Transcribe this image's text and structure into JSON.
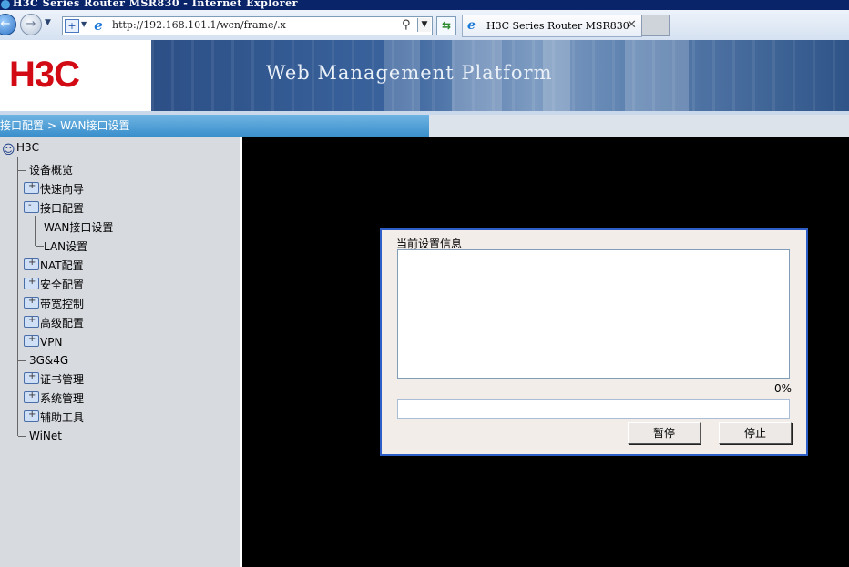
{
  "window": {
    "title": "H3C Series Router MSR830 - Internet Explorer"
  },
  "browser": {
    "address": "http://192.168.101.1/wcn/frame/.x",
    "tab_label": "H3C Series Router MSR830"
  },
  "banner": {
    "logo": "H3C",
    "title": "Web Management Platform"
  },
  "breadcrumb": {
    "items": [
      "接口配置",
      "WAN接口设置"
    ],
    "separator": ">"
  },
  "tree": {
    "root": "H3C",
    "items": [
      {
        "label": "设备概览",
        "level": 1,
        "folder": false
      },
      {
        "label": "快速向导",
        "level": 1,
        "folder": true,
        "open": false
      },
      {
        "label": "接口配置",
        "level": 1,
        "folder": true,
        "open": true
      },
      {
        "label": "WAN接口设置",
        "level": 2,
        "folder": false
      },
      {
        "label": "LAN设置",
        "level": 2,
        "folder": false
      },
      {
        "label": "NAT配置",
        "level": 1,
        "folder": true,
        "open": false
      },
      {
        "label": "安全配置",
        "level": 1,
        "folder": true,
        "open": false
      },
      {
        "label": "带宽控制",
        "level": 1,
        "folder": true,
        "open": false
      },
      {
        "label": "高级配置",
        "level": 1,
        "folder": true,
        "open": false
      },
      {
        "label": "VPN",
        "level": 1,
        "folder": true,
        "open": false
      },
      {
        "label": "3G&4G",
        "level": 1,
        "folder": false
      },
      {
        "label": "证书管理",
        "level": 1,
        "folder": true,
        "open": false
      },
      {
        "label": "系统管理",
        "level": 1,
        "folder": true,
        "open": false
      },
      {
        "label": "辅助工具",
        "level": 1,
        "folder": true,
        "open": false
      },
      {
        "label": "WiNet",
        "level": 1,
        "folder": false
      }
    ]
  },
  "dialog": {
    "title": "当前设置信息",
    "info_text": "",
    "progress_percent": 0,
    "progress_label": "0%",
    "pause_label": "暂停",
    "stop_label": "停止"
  },
  "colors": {
    "brand": "#d20a14",
    "dialog_border": "#2d5fc7",
    "breadcrumb": "#3a8fcc"
  }
}
